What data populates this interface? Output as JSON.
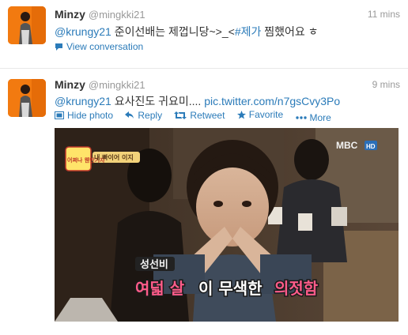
{
  "tweets": [
    {
      "name": "Minzy",
      "handle": "@mingkki21",
      "time": "11 mins",
      "mention": "@krungy21",
      "text_a": " 준이선배는 제껍니당~>_<",
      "hashtag": "#제가",
      "text_b": " 찜했어요 ㅎ",
      "action_view": "View conversation"
    },
    {
      "name": "Minzy",
      "handle": "@mingkki21",
      "time": "9 mins",
      "mention": "@krungy21",
      "text_a": " 요사진도 귀요미.... ",
      "link": "pic.twitter.com/n7gsCvy3Po",
      "actions": {
        "hide_photo": "Hide photo",
        "reply": "Reply",
        "retweet": "Retweet",
        "favorite": "Favorite",
        "more": "More"
      },
      "photo": {
        "caption_top": "성선비",
        "caption_main_a": "여덟 살",
        "caption_main_b": "이 무색한 ",
        "caption_main_c": "의젓함",
        "logo": "MBC",
        "logo_sub": "HD",
        "badge": "어쩌나 웬만기자",
        "badge2": "내 빠이어 이지"
      }
    }
  ],
  "colors": {
    "link": "#2b7bb9",
    "avatar_bg": "#f27a10",
    "caption_pink": "#ff5c8a",
    "caption_green": "#6ee06e",
    "caption_yellow": "#ffde3b"
  }
}
